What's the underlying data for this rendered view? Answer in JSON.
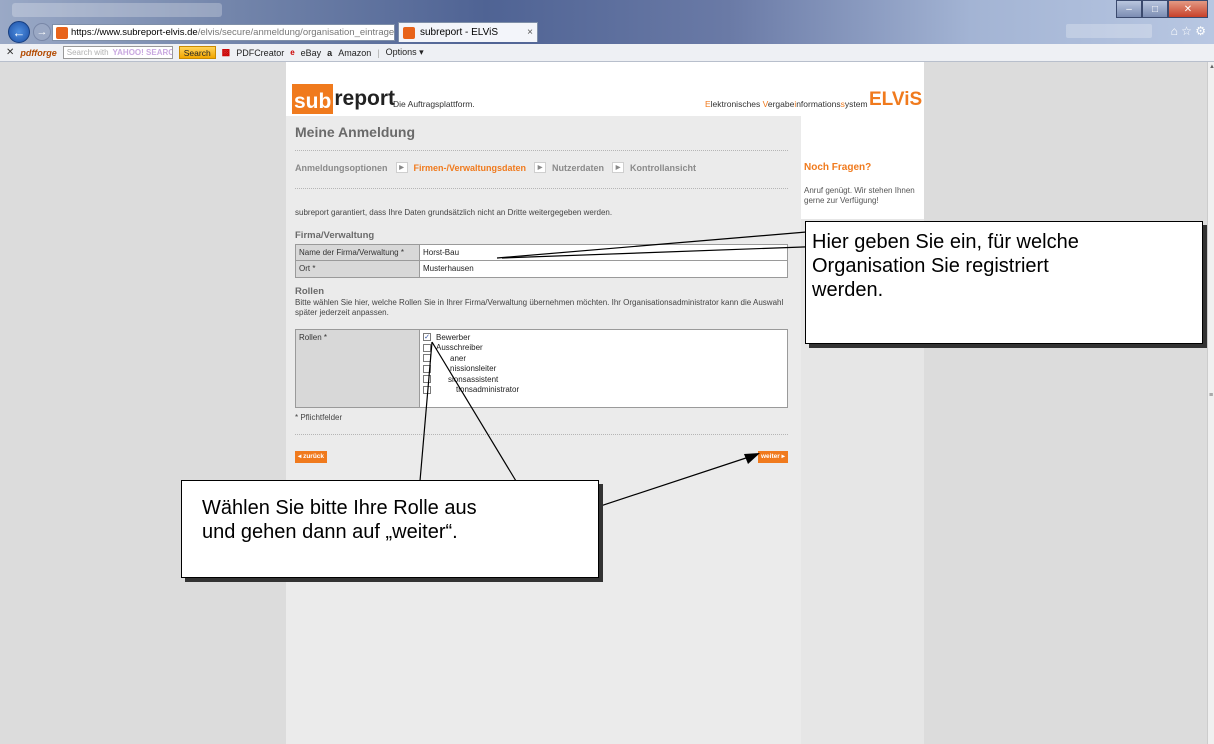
{
  "browser": {
    "url_host": "https://www.subreport-elvis.de",
    "url_path": "/elvis/secure/anmeldung/organisation_eintrage",
    "url_icons": "⌕ ▾ 🔒 ☒ ↻ ✕",
    "tab_title": "subreport - ELViS",
    "tab_close": "×",
    "window_min": "–",
    "window_max": "□",
    "window_close": "✕",
    "right_icons": "⌂ ☆ ⚙",
    "back": "←",
    "forward": "→",
    "toolbar": {
      "close": "✕",
      "pdfforge": "pdfforge",
      "search_placeholder": "Search with",
      "yahoo": "YAHOO! SEARCH",
      "search_button": "Search",
      "pdfcreator": "PDFCreator",
      "ebay": "eBay",
      "amazon": "Amazon",
      "options": "Options ▾"
    }
  },
  "header": {
    "logo_sub": "sub",
    "logo_report": "report",
    "tagline": "Die Auftragsplattform.",
    "elvis_e": "E",
    "elvis_part1": "lektronisches ",
    "elvis_v": "V",
    "elvis_part2": "ergabe",
    "elvis_i": "i",
    "elvis_part3": "nformations",
    "elvis_s": "s",
    "elvis_part4": "ystem",
    "elvis_logo": "ELViS"
  },
  "main": {
    "title": "Meine Anmeldung",
    "steps": [
      "Anmeldungsoptionen",
      "Firmen-/Verwaltungsdaten",
      "Nutzerdaten",
      "Kontrollansicht"
    ],
    "step_arrow": "▶",
    "info": "subreport garantiert, dass Ihre Daten grundsätzlich nicht an Dritte weitergegeben werden.",
    "firma_title": "Firma/Verwaltung",
    "fields": [
      {
        "label": "Name der Firma/Verwaltung *",
        "value": "Horst-Bau"
      },
      {
        "label": "Ort *",
        "value": "Musterhausen"
      }
    ],
    "rollen_title": "Rollen",
    "rollen_desc": "Bitte wählen Sie hier, welche Rollen Sie in Ihrer Firma/Verwaltung übernehmen möchten. Ihr Organisationsadministrator kann die Auswahl später jederzeit anpassen.",
    "rollen_label": "Rollen *",
    "roles": [
      "Bewerber",
      "Ausschreiber",
      "aner",
      "nissionsleiter",
      "sionsassistent",
      "tionsadministrator"
    ],
    "checked_mark": "✓",
    "pflicht": "* Pflichtfelder",
    "back_button": "◂ zurück",
    "next_button": "weiter ▸"
  },
  "sidebar": {
    "title": "Noch Fragen?",
    "text": "Anruf genügt. Wir stehen Ihnen gerne zur Verfügung!"
  },
  "callouts": {
    "top": [
      "Hier geben Sie ein, für welche",
      "Organisation Sie registriert",
      "werden."
    ],
    "bottom": [
      "Wählen Sie bitte Ihre Rolle aus",
      "und gehen dann auf „weiter“."
    ]
  },
  "scrollbar": {
    "up": "▲",
    "mark": "≡"
  }
}
